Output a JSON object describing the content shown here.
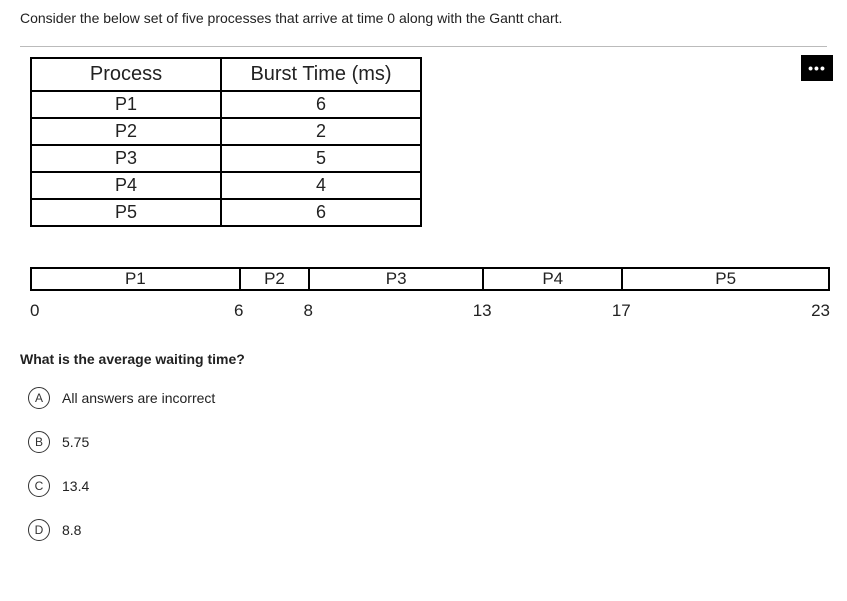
{
  "question_intro": "Consider the below set of five processes that arrive at time 0 along with the Gantt chart.",
  "menu_glyph": "•••",
  "process_table": {
    "headers": [
      "Process",
      "Burst Time (ms)"
    ],
    "rows": [
      {
        "name": "P1",
        "burst": "6"
      },
      {
        "name": "P2",
        "burst": "2"
      },
      {
        "name": "P3",
        "burst": "5"
      },
      {
        "name": "P4",
        "burst": "4"
      },
      {
        "name": "P5",
        "burst": "6"
      }
    ]
  },
  "gantt": {
    "total": 23,
    "bars": [
      {
        "label": "P1",
        "start": 0,
        "end": 6
      },
      {
        "label": "P2",
        "start": 6,
        "end": 8
      },
      {
        "label": "P3",
        "start": 8,
        "end": 13
      },
      {
        "label": "P4",
        "start": 13,
        "end": 17
      },
      {
        "label": "P5",
        "start": 17,
        "end": 23
      }
    ],
    "ticks": [
      "0",
      "6",
      "8",
      "13",
      "17",
      "23"
    ]
  },
  "question_text": "What is the average waiting time?",
  "options": [
    {
      "letter": "A",
      "text": "All answers are incorrect"
    },
    {
      "letter": "B",
      "text": "5.75"
    },
    {
      "letter": "C",
      "text": "13.4"
    },
    {
      "letter": "D",
      "text": "8.8"
    }
  ]
}
